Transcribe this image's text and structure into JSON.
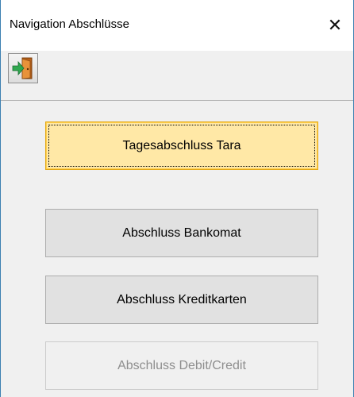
{
  "window": {
    "title": "Navigation Abschlüsse",
    "close_symbol": "✕"
  },
  "toolbar": {
    "exit_icon": "exit-door-icon"
  },
  "buttons": [
    {
      "label": "Tagesabschluss Tara",
      "state": "focused"
    },
    {
      "label": "Abschluss Bankomat",
      "state": "normal"
    },
    {
      "label": "Abschluss Kreditkarten",
      "state": "normal"
    },
    {
      "label": "Abschluss Debit/Credit",
      "state": "disabled"
    }
  ],
  "colors": {
    "focused_button_bg": "#ffe8a6",
    "focused_button_border": "#e3a817",
    "window_border": "#3c7fb1",
    "disabled_text": "#8e8e8e"
  }
}
